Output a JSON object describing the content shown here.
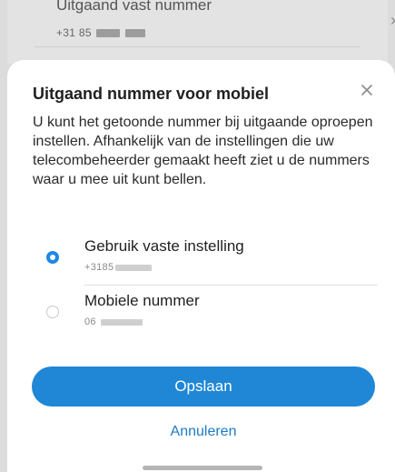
{
  "background_item": {
    "title": "Uitgaand vast nummer",
    "number_visible": "+31 85",
    "chevron": "›"
  },
  "dialog": {
    "title": "Uitgaand nummer voor mobiel",
    "close_icon": "close-icon",
    "description": "U kunt het getoonde nummer bij uitgaande oproepen instellen. Afhankelijk van de instellingen die uw telecombeheerder gemaakt heeft ziet u de nummers waar u mee uit kunt bellen.",
    "options": [
      {
        "label": "Gebruik vaste instelling",
        "number_visible": "+3185",
        "selected": true
      },
      {
        "label": "Mobiele nummer",
        "number_visible": "06",
        "selected": false
      }
    ],
    "save_label": "Opslaan",
    "cancel_label": "Annuleren"
  },
  "colors": {
    "accent": "#1f87d6",
    "link": "#1d7bc7",
    "radio_selected": "#1e88e5",
    "radio_unselected": "#c9c9c9"
  }
}
